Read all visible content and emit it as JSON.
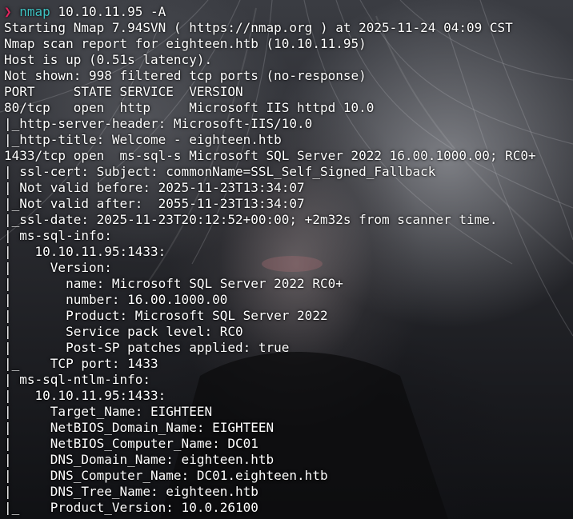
{
  "colors": {
    "prompt_arrow": "#e0245e",
    "command": "#3ec3c3",
    "output_text": "#ffffff"
  },
  "prompt": {
    "arrow": "❯",
    "command": "nmap",
    "args": "10.10.11.95 -A"
  },
  "output_lines": [
    "Starting Nmap 7.94SVN ( https://nmap.org ) at 2025-11-24 04:09 CST",
    "Nmap scan report for eighteen.htb (10.10.11.95)",
    "Host is up (0.51s latency).",
    "Not shown: 998 filtered tcp ports (no-response)",
    "PORT     STATE SERVICE  VERSION",
    "80/tcp   open  http     Microsoft IIS httpd 10.0",
    "|_http-server-header: Microsoft-IIS/10.0",
    "|_http-title: Welcome - eighteen.htb",
    "1433/tcp open  ms-sql-s Microsoft SQL Server 2022 16.00.1000.00; RC0+",
    "| ssl-cert: Subject: commonName=SSL_Self_Signed_Fallback",
    "| Not valid before: 2025-11-23T13:34:07",
    "|_Not valid after:  2055-11-23T13:34:07",
    "|_ssl-date: 2025-11-23T20:12:52+00:00; +2m32s from scanner time.",
    "| ms-sql-info:",
    "|   10.10.11.95:1433:",
    "|     Version:",
    "|       name: Microsoft SQL Server 2022 RC0+",
    "|       number: 16.00.1000.00",
    "|       Product: Microsoft SQL Server 2022",
    "|       Service pack level: RC0",
    "|       Post-SP patches applied: true",
    "|_    TCP port: 1433",
    "| ms-sql-ntlm-info:",
    "|   10.10.11.95:1433:",
    "|     Target_Name: EIGHTEEN",
    "|     NetBIOS_Domain_Name: EIGHTEEN",
    "|     NetBIOS_Computer_Name: DC01",
    "|     DNS_Domain_Name: eighteen.htb",
    "|     DNS_Computer_Name: DC01.eighteen.htb",
    "|     DNS_Tree_Name: eighteen.htb",
    "|_    Product_Version: 10.0.26100"
  ]
}
